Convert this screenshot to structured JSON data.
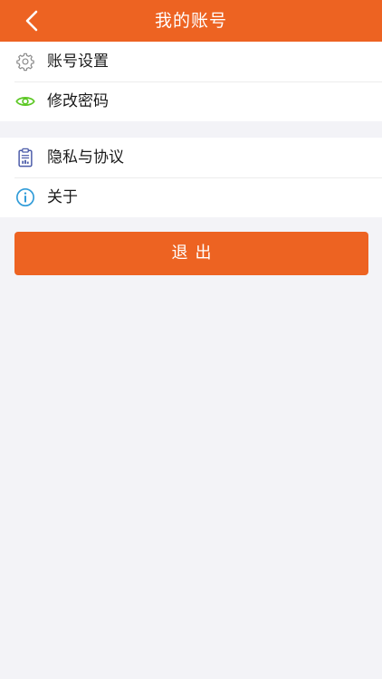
{
  "header": {
    "title": "我的账号",
    "back_icon": "chevron-left-icon"
  },
  "menu": {
    "group1": [
      {
        "label": "账号设置",
        "icon": "gear-icon"
      },
      {
        "label": "修改密码",
        "icon": "eye-icon"
      }
    ],
    "group2": [
      {
        "label": "隐私与协议",
        "icon": "clipboard-icon"
      },
      {
        "label": "关于",
        "icon": "info-icon"
      }
    ]
  },
  "logout": {
    "label": "退出"
  },
  "colors": {
    "accent": "#ed6322",
    "background": "#f3f3f7",
    "eye_icon": "#5dc825",
    "info_icon": "#2f9bd8",
    "clipboard_icon": "#4a5aa8",
    "gear_icon": "#8a8a8a"
  }
}
